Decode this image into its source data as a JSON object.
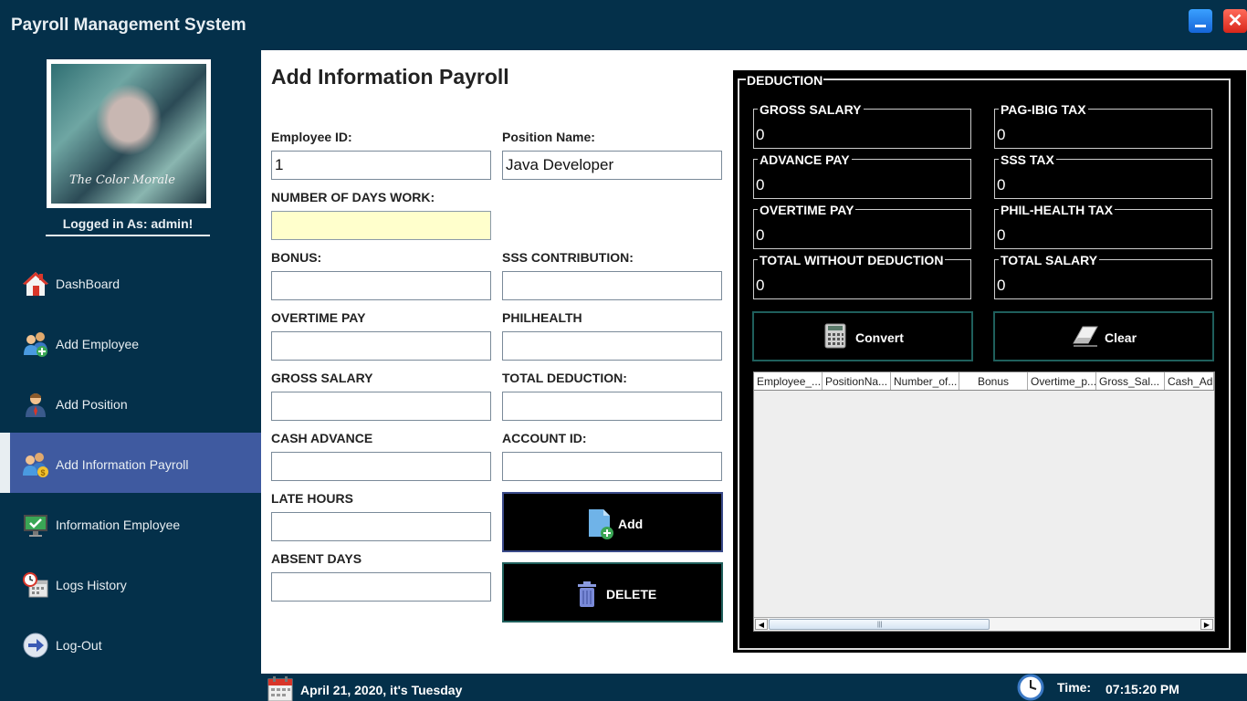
{
  "app": {
    "title": "Payroll Management System"
  },
  "window_controls": {
    "minimize": "",
    "close": "✕"
  },
  "sidebar": {
    "logged_in": "Logged in As: admin!",
    "items": [
      {
        "label": "DashBoard",
        "icon": "home-icon"
      },
      {
        "label": "Add Employee",
        "icon": "add-employee-icon"
      },
      {
        "label": "Add Position",
        "icon": "employee-icon"
      },
      {
        "label": "Add Information Payroll",
        "icon": "payroll-users-icon"
      },
      {
        "label": "Information Employee",
        "icon": "monitor-check-icon"
      },
      {
        "label": "Logs History",
        "icon": "clock-calendar-icon"
      },
      {
        "label": "Log-Out",
        "icon": "arrow-right-icon"
      }
    ],
    "active_index": 3
  },
  "form": {
    "title": "Add Information Payroll",
    "employee_id": {
      "label": "Employee ID:",
      "value": "1"
    },
    "position_name": {
      "label": "Position Name:",
      "value": "Java Developer"
    },
    "days_work": {
      "label": "NUMBER OF DAYS WORK:",
      "value": ""
    },
    "bonus": {
      "label": "BONUS:",
      "value": ""
    },
    "sss_contribution": {
      "label": "SSS CONTRIBUTION:",
      "value": ""
    },
    "overtime_pay": {
      "label": "OVERTIME PAY",
      "value": ""
    },
    "philhealth": {
      "label": "PHILHEALTH",
      "value": ""
    },
    "gross_salary": {
      "label": "GROSS SALARY",
      "value": ""
    },
    "total_deduction": {
      "label": "TOTAL DEDUCTION:",
      "value": ""
    },
    "cash_advance": {
      "label": "CASH ADVANCE",
      "value": ""
    },
    "account_id": {
      "label": "ACCOUNT ID:",
      "value": ""
    },
    "late_hours": {
      "label": "LATE HOURS",
      "value": ""
    },
    "absent_days": {
      "label": "ABSENT DAYS",
      "value": ""
    },
    "add_label": "Add",
    "delete_label": "DELETE"
  },
  "deduction": {
    "legend": "DEDUCTION",
    "gross_salary": {
      "label": "GROSS SALARY",
      "value": "0"
    },
    "pagibig_tax": {
      "label": "PAG-IBIG TAX",
      "value": "0"
    },
    "advance_pay": {
      "label": "ADVANCE PAY",
      "value": "0"
    },
    "sss_tax": {
      "label": "SSS TAX",
      "value": "0"
    },
    "overtime_pay": {
      "label": "OVERTIME PAY",
      "value": "0"
    },
    "philhealth_tax": {
      "label": "PHIL-HEALTH TAX",
      "value": "0"
    },
    "total_without_deduction": {
      "label": "TOTAL WITHOUT DEDUCTION",
      "value": "0"
    },
    "total_salary": {
      "label": "TOTAL SALARY",
      "value": "0"
    },
    "convert_label": "Convert",
    "clear_label": "Clear"
  },
  "table": {
    "columns": [
      "Employee_...",
      "PositionNa...",
      "Number_of...",
      "Bonus",
      "Overtime_p...",
      "Gross_Sal...",
      "Cash_Ad"
    ],
    "rows": []
  },
  "status": {
    "date": "April 21, 2020, it's Tuesday",
    "time_label": "Time:",
    "time": "07:15:20 PM"
  }
}
